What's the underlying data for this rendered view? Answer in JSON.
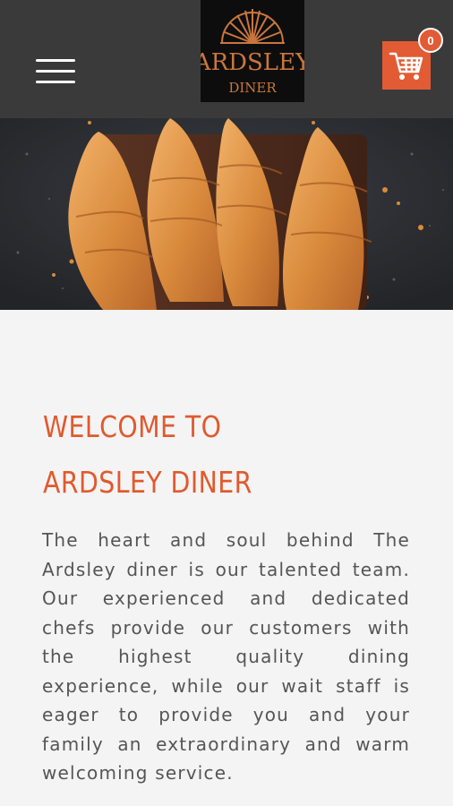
{
  "header": {
    "menu_icon": "hamburger-menu-icon",
    "logo": {
      "line1": "ARDSLEY",
      "line2": "DINER"
    },
    "cart": {
      "icon": "shopping-cart-icon",
      "count": "0"
    }
  },
  "hero": {
    "description": "croissants on wooden board"
  },
  "welcome": {
    "title_line1": "WELCOME TO",
    "title_line2": "ARDSLEY DINER",
    "body": "The heart and soul behind The Ardsley diner is our talented team. Our experienced and dedicated chefs provide our customers with the highest quality dining experience, while our wait staff is eager to provide you and your family an extraordinary and warm welcoming service."
  },
  "colors": {
    "accent": "#e25b35",
    "header_bg": "#3a3a3a",
    "page_bg": "#f4f4f4"
  }
}
